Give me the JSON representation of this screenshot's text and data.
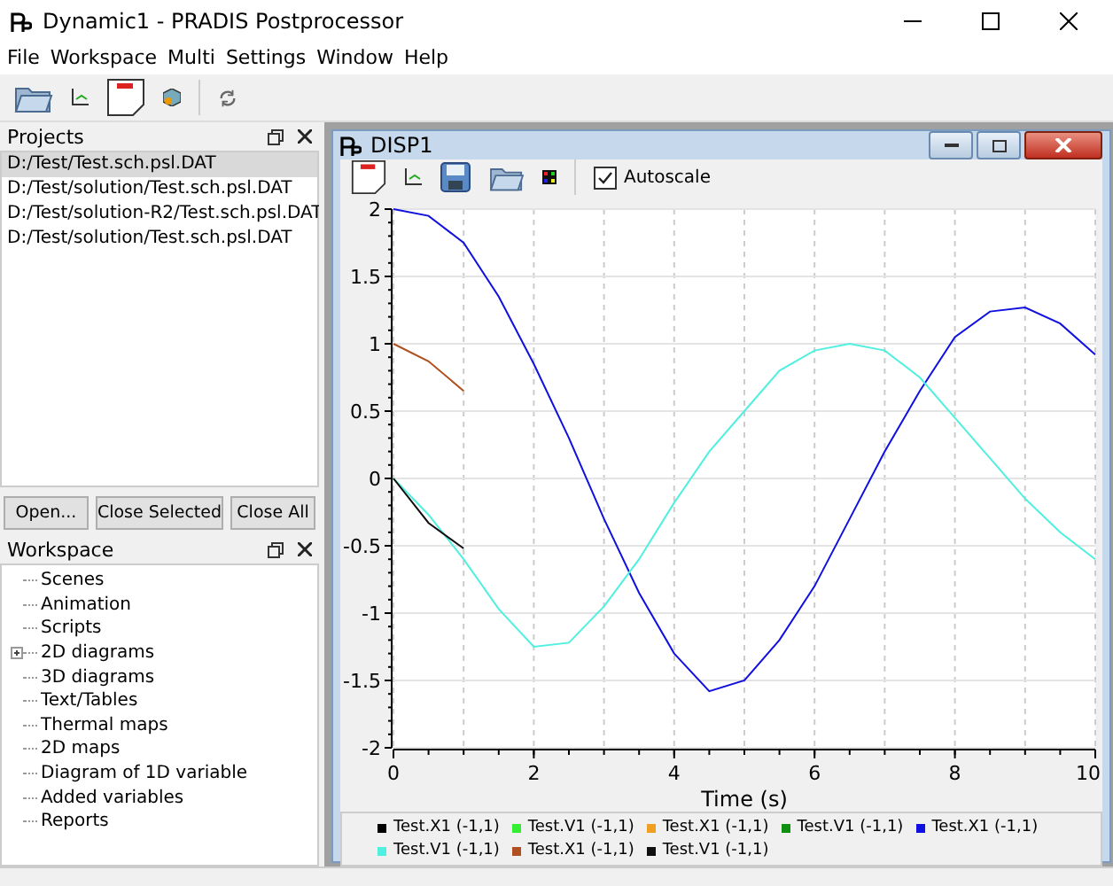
{
  "window": {
    "title": "Dynamic1 - PRADIS Postprocessor"
  },
  "menu": [
    {
      "label": "File"
    },
    {
      "label": "Workspace"
    },
    {
      "label": "Multi"
    },
    {
      "label": "Settings"
    },
    {
      "label": "Window"
    },
    {
      "label": "Help"
    }
  ],
  "projects": {
    "title": "Projects",
    "items": [
      {
        "label": "D:/Test/Test.sch.psl.DAT",
        "selected": true
      },
      {
        "label": "D:/Test/solution/Test.sch.psl.DAT",
        "selected": false
      },
      {
        "label": "D:/Test/solution-R2/Test.sch.psl.DAT",
        "selected": false
      },
      {
        "label": "D:/Test/solution/Test.sch.psl.DAT",
        "selected": false
      }
    ],
    "buttons": [
      "Open...",
      "Close Selected",
      "Close All"
    ]
  },
  "workspace": {
    "title": "Workspace",
    "items": [
      {
        "label": "Scenes",
        "expandable": false
      },
      {
        "label": "Animation",
        "expandable": false
      },
      {
        "label": "Scripts",
        "expandable": false
      },
      {
        "label": "2D diagrams",
        "expandable": true
      },
      {
        "label": "3D diagrams",
        "expandable": false
      },
      {
        "label": "Text/Tables",
        "expandable": false
      },
      {
        "label": "Thermal maps",
        "expandable": false
      },
      {
        "label": "2D maps",
        "expandable": false
      },
      {
        "label": "Diagram of 1D variable",
        "expandable": false
      },
      {
        "label": "Added variables",
        "expandable": false
      },
      {
        "label": "Reports",
        "expandable": false
      }
    ]
  },
  "subwindow": {
    "title": "DISP1",
    "autoscale": {
      "label": "Autoscale",
      "checked": true
    },
    "chart_data": {
      "type": "line",
      "grid": true,
      "xlabel": "Time (s)",
      "x": [
        0,
        0.5,
        1,
        1.5,
        2,
        2.5,
        3,
        3.5,
        4,
        4.5,
        5,
        5.5,
        6,
        6.5,
        7,
        7.5,
        8,
        8.5,
        9,
        9.5,
        10
      ],
      "xlim": [
        0,
        10
      ],
      "ylim": [
        -2,
        2
      ],
      "xticks": [
        0,
        2,
        4,
        6,
        8,
        10
      ],
      "yticks": [
        -2,
        -1.5,
        -1,
        -0.5,
        0,
        0.5,
        1,
        1.5,
        2
      ],
      "series": [
        {
          "name": "Test.X1 (-1,1)",
          "color": "#000000",
          "values": [
            null,
            null,
            null,
            null,
            null,
            null,
            null,
            null,
            null,
            null,
            null,
            null,
            null,
            null,
            null,
            null,
            null,
            null,
            null,
            null,
            null
          ]
        },
        {
          "name": "Test.V1 (-1,1)",
          "color": "#33ee33",
          "values": [
            null,
            null,
            null,
            null,
            null,
            null,
            null,
            null,
            null,
            null,
            null,
            null,
            null,
            null,
            null,
            null,
            null,
            null,
            null,
            null,
            null
          ]
        },
        {
          "name": "Test.X1 (-1,1)",
          "color": "#f0a020",
          "values": [
            null,
            null,
            null,
            null,
            null,
            null,
            null,
            null,
            null,
            null,
            null,
            null,
            null,
            null,
            null,
            null,
            null,
            null,
            null,
            null,
            null
          ]
        },
        {
          "name": "Test.V1 (-1,1)",
          "color": "#109010",
          "values": [
            null,
            null,
            null,
            null,
            null,
            null,
            null,
            null,
            null,
            null,
            null,
            null,
            null,
            null,
            null,
            null,
            null,
            null,
            null,
            null,
            null
          ]
        },
        {
          "name": "Test.X1 (-1,1)",
          "color": "#1010e0",
          "values": [
            2,
            1.95,
            1.75,
            1.35,
            0.85,
            0.3,
            -0.3,
            -0.85,
            -1.3,
            -1.58,
            -1.5,
            -1.2,
            -0.8,
            -0.3,
            0.2,
            0.65,
            1.05,
            1.24,
            1.27,
            1.15,
            0.92
          ]
        },
        {
          "name": "Test.V1 (-1,1)",
          "color": "#50f0e0",
          "values": [
            0,
            -0.27,
            -0.6,
            -0.97,
            -1.25,
            -1.22,
            -0.95,
            -0.6,
            -0.18,
            0.2,
            0.5,
            0.8,
            0.95,
            1.0,
            0.95,
            0.75,
            0.45,
            0.15,
            -0.15,
            -0.4,
            -0.6
          ]
        },
        {
          "name": "Test.X1 (-1,1)",
          "color": "#b05020",
          "values": [
            1,
            0.87,
            0.65,
            null,
            null,
            null,
            null,
            null,
            null,
            null,
            null,
            null,
            null,
            null,
            null,
            null,
            null,
            null,
            null,
            null,
            null
          ]
        },
        {
          "name": "Test.V1 (-1,1)",
          "color": "#101010",
          "values": [
            0,
            -0.33,
            -0.52,
            null,
            null,
            null,
            null,
            null,
            null,
            null,
            null,
            null,
            null,
            null,
            null,
            null,
            null,
            null,
            null,
            null,
            null
          ]
        }
      ]
    }
  }
}
